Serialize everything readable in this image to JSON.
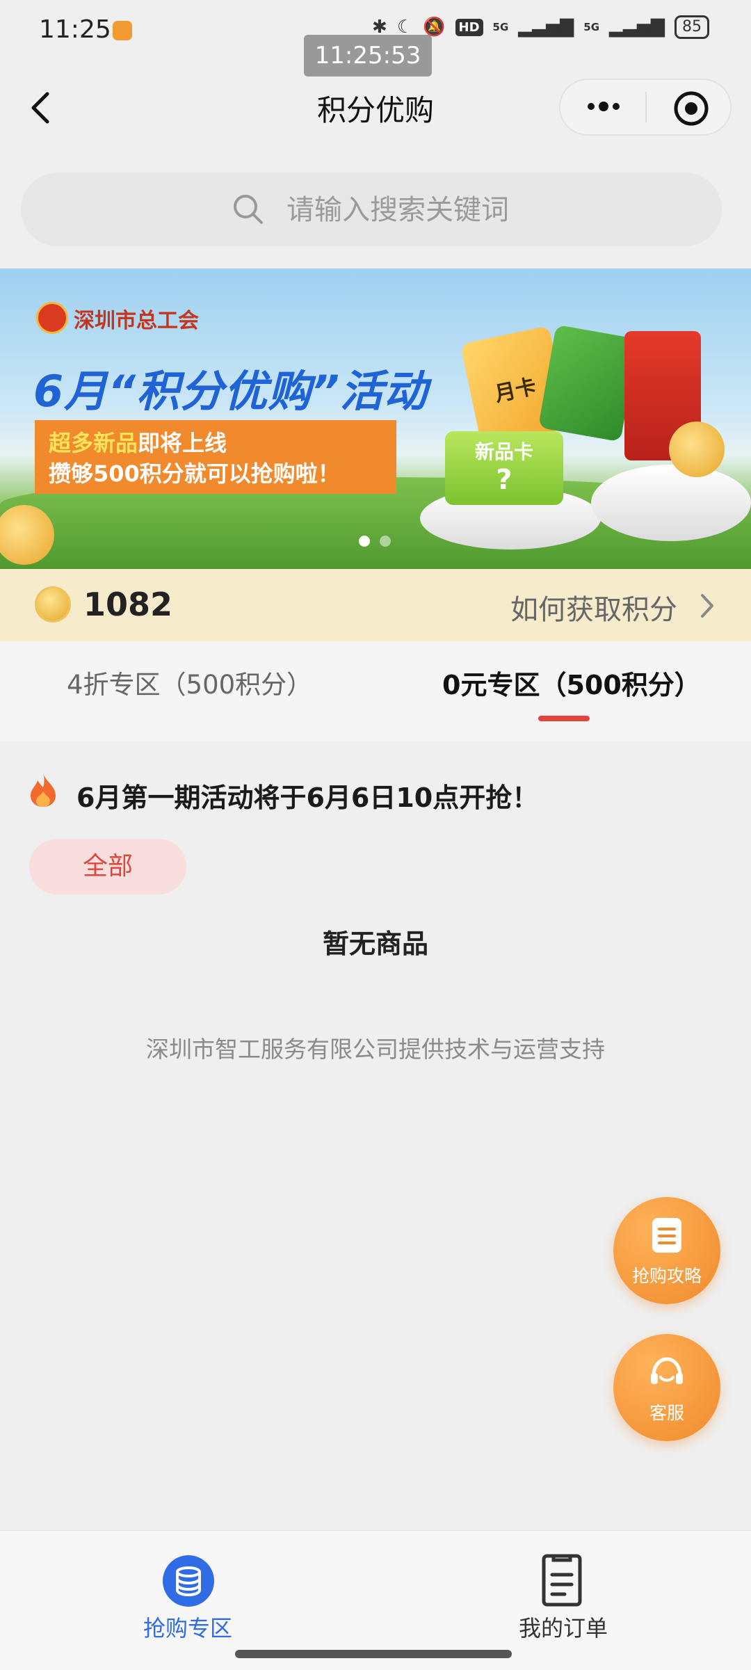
{
  "status_bar": {
    "time": "11:25",
    "clock_overlay": "11:25:53",
    "network_1": "5G",
    "network_2": "5G",
    "hd_badge": "HD",
    "battery": "85"
  },
  "nav": {
    "title": "积分优购"
  },
  "search": {
    "placeholder": "请输入搜索关键词"
  },
  "banner": {
    "org_name": "深圳市总工会",
    "headline": "6月“积分优购”活动",
    "line1_highlight": "超多新品",
    "line1_rest": "即将上线",
    "line2": "攒够500积分就可以抢购啦！",
    "card_month_label": "月卡",
    "card_new_label": "新品卡",
    "card_new_mark": "?",
    "slide_count": 2,
    "active_slide": 1
  },
  "points": {
    "value": "1082",
    "link_label": "如何获取积分"
  },
  "tabs": [
    {
      "label": "4折专区（500积分）",
      "active": false
    },
    {
      "label": "0元专区（500积分）",
      "active": true
    }
  ],
  "notice": {
    "text": "6月第一期活动将于6月6日10点开抢！"
  },
  "filter": {
    "chip_label": "全部"
  },
  "empty_state": {
    "text": "暂无商品"
  },
  "footer": {
    "credit": "深圳市智工服务有限公司提供技术与运营支持"
  },
  "fabs": {
    "guide_label": "抢购攻略",
    "service_label": "客服"
  },
  "bottom_nav": {
    "items": [
      {
        "label": "抢购专区",
        "active": true
      },
      {
        "label": "我的订单",
        "active": false
      }
    ]
  },
  "colors": {
    "accent_red": "#e2433c",
    "accent_blue": "#2f6ce5",
    "fab_orange": "#f08a2c",
    "points_bg": "#f6eccc"
  }
}
